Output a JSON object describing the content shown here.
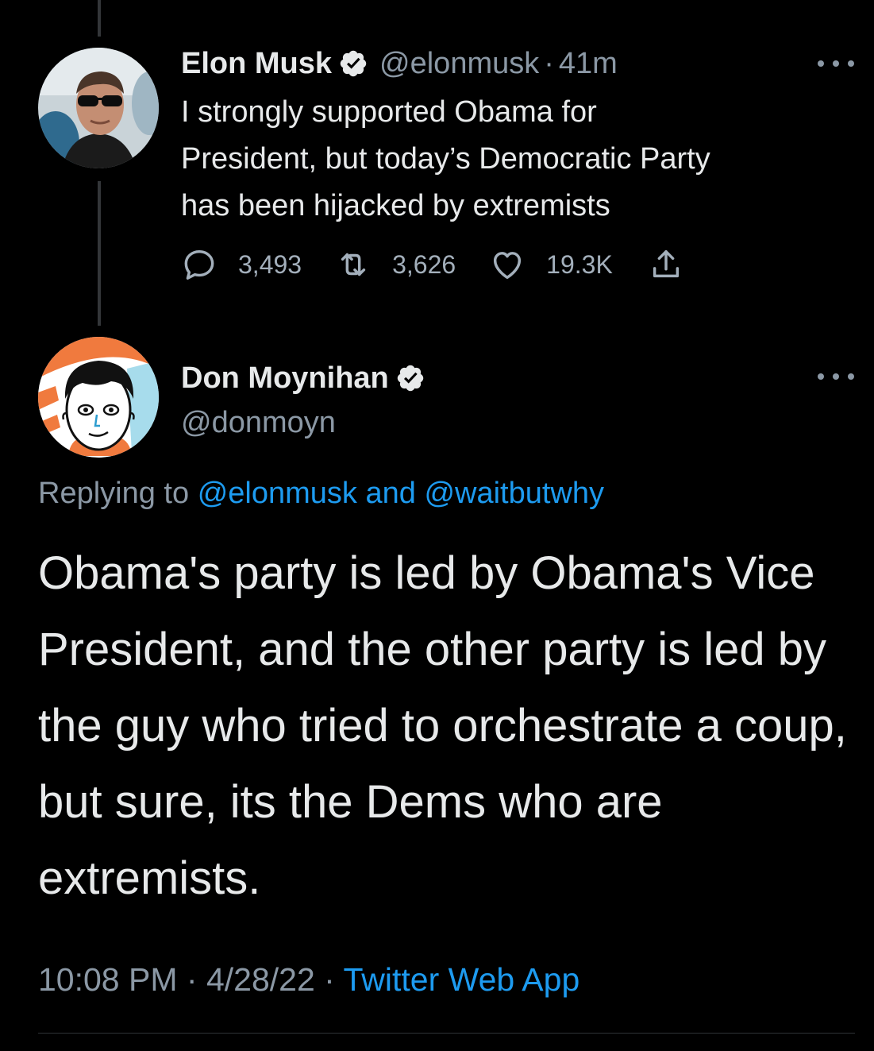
{
  "colors": {
    "background": "#000000",
    "text_primary": "#e7e9ea",
    "text_secondary": "#8b98a5",
    "link": "#1d9bf0",
    "verified_badge": "#e7e9ea"
  },
  "parent_tweet": {
    "author_name": "Elon Musk",
    "handle": "@elonmusk",
    "separator": "·",
    "time_ago": "41m",
    "text_lines": [
      "I strongly supported Obama for",
      "President, but today’s Democratic Party",
      "has been hijacked by extremists"
    ],
    "actions": {
      "replies": "3,493",
      "retweets": "3,626",
      "likes": "19.3K"
    },
    "icons": {
      "reply": "reply-icon",
      "retweet": "retweet-icon",
      "like": "heart-icon",
      "share": "share-icon",
      "more": "more-icon",
      "verified": "verified-badge-icon"
    }
  },
  "focused_tweet": {
    "author_name": "Don Moynihan",
    "handle": "@donmoyn",
    "replying_to_prefix": "Replying to",
    "reply_target_1": "@elonmusk",
    "reply_and": "and",
    "reply_target_2": "@waitbutwhy",
    "text": "Obama's party is led by Obama's Vice President, and the other party is led by the guy who tried to orchestrate a coup, but sure, its the Dems who are extremists.",
    "time": "10:08 PM",
    "separator": "·",
    "date": "4/28/22",
    "source": "Twitter Web App"
  }
}
